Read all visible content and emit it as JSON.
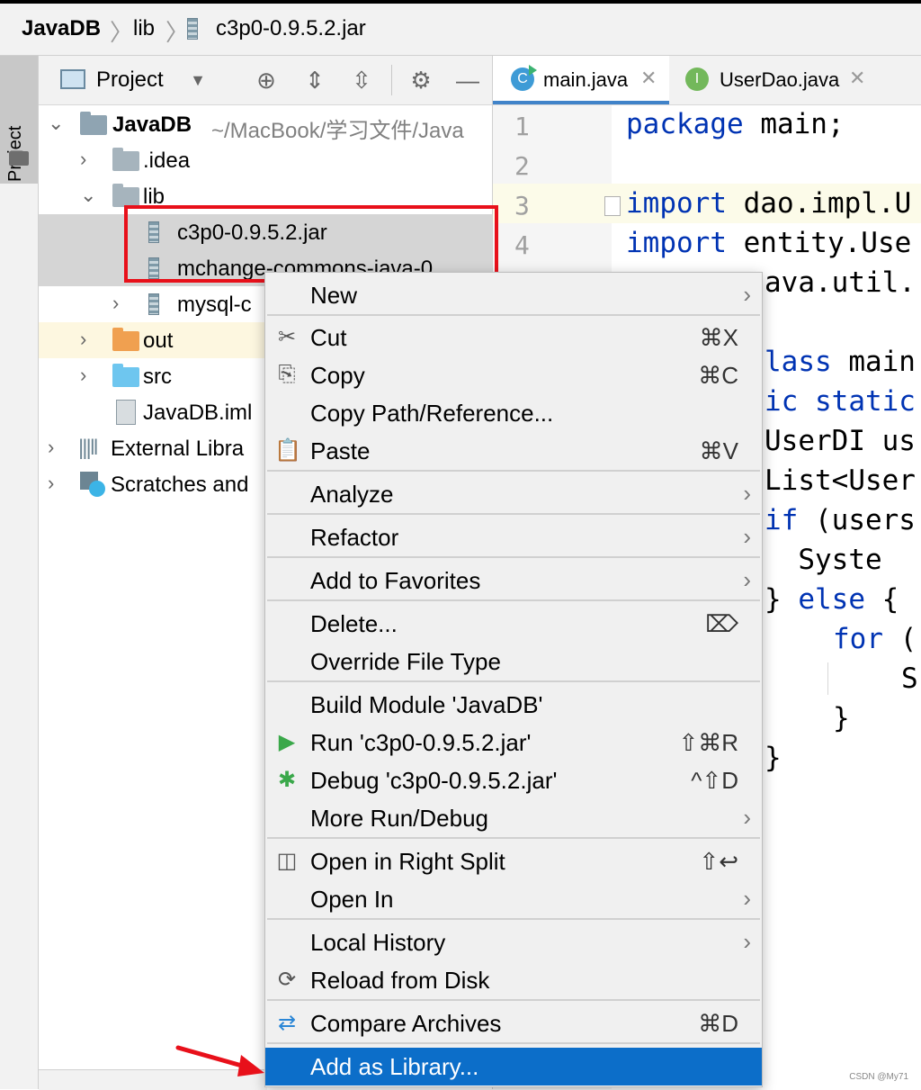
{
  "breadcrumb": {
    "project": "JavaDB",
    "folder": "lib",
    "file": "c3p0-0.9.5.2.jar"
  },
  "sidebar_stripe": {
    "label": "Project"
  },
  "project_toolbar": {
    "title": "Project"
  },
  "tree": {
    "root": {
      "name": "JavaDB",
      "path": "~/MacBook/学习文件/Java"
    },
    "idea": ".idea",
    "lib": "lib",
    "jar1": "c3p0-0.9.5.2.jar",
    "jar2": "mchange-commons-java-0.",
    "jar3": "mysql-c",
    "out": "out",
    "src": "src",
    "iml": "JavaDB.iml",
    "external": "External Libra",
    "scratches": "Scratches and"
  },
  "editor": {
    "tabs": [
      {
        "label": "main.java",
        "icon": "C"
      },
      {
        "label": "UserDao.java",
        "icon": "I"
      }
    ],
    "line_numbers": [
      "1",
      "2",
      "3",
      "4"
    ],
    "code": {
      "l1_kw": "package",
      "l1_rest": " main;",
      "l3_kw": "import",
      "l3_rest": " dao.impl.U",
      "l4_kw": "import",
      "l4_rest": " entity.Use",
      "l5_rest": "ava.util.",
      "l7_kw": "lass",
      "l7_rest": " main",
      "l8_kw": "ic static",
      "l9_rest": "UserDI us",
      "l10_rest": "List<User",
      "l11_kw": "if",
      "l11_rest": " (users",
      "l12_rest": "  Syste",
      "l13_a": "} ",
      "l13_kw": "else",
      "l13_rest": " {",
      "l14_kw": "for",
      "l14_rest": " (",
      "l15_rest": "S",
      "l16_rest": "}",
      "l17_rest": "}"
    }
  },
  "context_menu": {
    "new": "New",
    "cut": "Cut",
    "cut_sc": "⌘X",
    "copy": "Copy",
    "copy_sc": "⌘C",
    "copy_path": "Copy Path/Reference...",
    "paste": "Paste",
    "paste_sc": "⌘V",
    "analyze": "Analyze",
    "refactor": "Refactor",
    "favorites": "Add to Favorites",
    "delete": "Delete...",
    "delete_sc": "⌦",
    "override": "Override File Type",
    "build": "Build Module 'JavaDB'",
    "run": "Run 'c3p0-0.9.5.2.jar'",
    "run_sc": "⇧⌘R",
    "debug": "Debug 'c3p0-0.9.5.2.jar'",
    "debug_sc": "^⇧D",
    "more_run": "More Run/Debug",
    "open_right": "Open in Right Split",
    "open_right_sc": "⇧↩",
    "open_in": "Open In",
    "local_history": "Local History",
    "reload": "Reload from Disk",
    "compare": "Compare Archives",
    "compare_sc": "⌘D",
    "add_library": "Add as Library..."
  },
  "watermark": "CSDN @My71",
  "colors": {
    "selection": "#0c6ec9",
    "keyword": "#0033b3",
    "highlight": "#e8101a",
    "out_folder": "#f0a050",
    "src_folder": "#6ec6ef"
  }
}
